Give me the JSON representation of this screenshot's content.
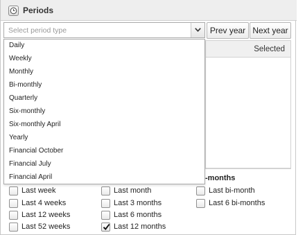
{
  "panel": {
    "title": "Periods",
    "icon": "clock-icon"
  },
  "period_select": {
    "placeholder": "Select period type"
  },
  "buttons": {
    "prev": "Prev year",
    "next": "Next year"
  },
  "dropdown": {
    "items": [
      "Daily",
      "Weekly",
      "Monthly",
      "Bi-monthly",
      "Quarterly",
      "Six-monthly",
      "Six-monthly April",
      "Yearly",
      "Financial October",
      "Financial July",
      "Financial April"
    ]
  },
  "selected": {
    "label": "Selected"
  },
  "bimonths_heading": "-months",
  "relative": {
    "col1": [
      {
        "label": "Last week",
        "checked": false
      },
      {
        "label": "Last 4 weeks",
        "checked": false
      },
      {
        "label": "Last 12 weeks",
        "checked": false
      },
      {
        "label": "Last 52 weeks",
        "checked": false
      }
    ],
    "col2": [
      {
        "label": "Last month",
        "checked": false
      },
      {
        "label": "Last 3 months",
        "checked": false
      },
      {
        "label": "Last 6 months",
        "checked": false
      },
      {
        "label": "Last 12 months",
        "checked": true
      }
    ],
    "col3": [
      {
        "label": "Last bi-month",
        "checked": false
      },
      {
        "label": "Last 6 bi-months",
        "checked": false
      }
    ]
  }
}
